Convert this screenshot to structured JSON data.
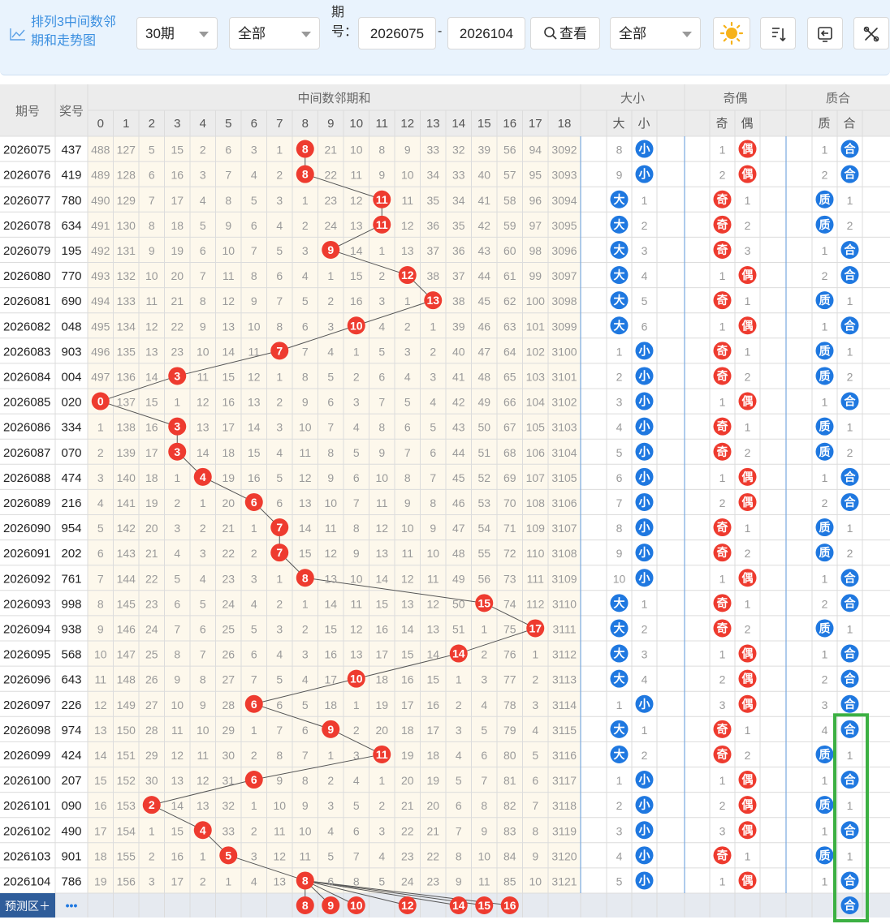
{
  "toolbar": {
    "title": "排列3中间数邻期和走势图",
    "period_select": "30期",
    "filter_select": "全部",
    "issue_label": "期号：",
    "issue_from": "2026075",
    "issue_dash": "-",
    "issue_to": "2026104",
    "query_button": "查看",
    "filter_select_2": "全部",
    "icons": [
      "sun-icon",
      "sort-icon",
      "back-icon",
      "tools-icon"
    ]
  },
  "headers": {
    "issue": "期号",
    "award": "奖号",
    "main_group": "中间数邻期和",
    "dx_group": "大小",
    "jo_group": "奇偶",
    "zh_group": "质合",
    "main_cols": [
      "0",
      "1",
      "2",
      "3",
      "4",
      "5",
      "6",
      "7",
      "8",
      "9",
      "10",
      "11",
      "12",
      "13",
      "14",
      "15",
      "16",
      "17",
      "18"
    ],
    "dx_cols": [
      "大",
      "小"
    ],
    "jo_cols": [
      "奇",
      "偶"
    ],
    "zh_cols": [
      "质",
      "合"
    ]
  },
  "rows": [
    {
      "issue": "2026075",
      "award": "437",
      "main": [
        "488",
        "127",
        "5",
        "15",
        "2",
        "6",
        "3",
        "1",
        "8",
        "21",
        "10",
        "8",
        "9",
        "33",
        "32",
        "39",
        "56",
        "94",
        "3092"
      ],
      "hit": 8,
      "dx": [
        "8",
        "小"
      ],
      "jo": [
        "1",
        "偶"
      ],
      "zh": [
        "1",
        "合"
      ]
    },
    {
      "issue": "2026076",
      "award": "419",
      "main": [
        "489",
        "128",
        "6",
        "16",
        "3",
        "7",
        "4",
        "2",
        "8",
        "22",
        "11",
        "9",
        "10",
        "34",
        "33",
        "40",
        "57",
        "95",
        "3093"
      ],
      "hit": 8,
      "dx": [
        "9",
        "小"
      ],
      "jo": [
        "2",
        "偶"
      ],
      "zh": [
        "2",
        "合"
      ]
    },
    {
      "issue": "2026077",
      "award": "780",
      "main": [
        "490",
        "129",
        "7",
        "17",
        "4",
        "8",
        "5",
        "3",
        "1",
        "23",
        "12",
        "11",
        "11",
        "35",
        "34",
        "41",
        "58",
        "96",
        "3094"
      ],
      "hit": 11,
      "dx": [
        "大",
        "1"
      ],
      "jo": [
        "奇",
        "1"
      ],
      "zh": [
        "质",
        "1"
      ]
    },
    {
      "issue": "2026078",
      "award": "634",
      "main": [
        "491",
        "130",
        "8",
        "18",
        "5",
        "9",
        "6",
        "4",
        "2",
        "24",
        "13",
        "11",
        "12",
        "36",
        "35",
        "42",
        "59",
        "97",
        "3095"
      ],
      "hit": 11,
      "dx": [
        "大",
        "2"
      ],
      "jo": [
        "奇",
        "2"
      ],
      "zh": [
        "质",
        "2"
      ]
    },
    {
      "issue": "2026079",
      "award": "195",
      "main": [
        "492",
        "131",
        "9",
        "19",
        "6",
        "10",
        "7",
        "5",
        "3",
        "9",
        "14",
        "1",
        "13",
        "37",
        "36",
        "43",
        "60",
        "98",
        "3096"
      ],
      "hit": 9,
      "dx": [
        "大",
        "3"
      ],
      "jo": [
        "奇",
        "3"
      ],
      "zh": [
        "1",
        "合"
      ]
    },
    {
      "issue": "2026080",
      "award": "770",
      "main": [
        "493",
        "132",
        "10",
        "20",
        "7",
        "11",
        "8",
        "6",
        "4",
        "1",
        "15",
        "2",
        "12",
        "38",
        "37",
        "44",
        "61",
        "99",
        "3097"
      ],
      "hit": 12,
      "dx": [
        "大",
        "4"
      ],
      "jo": [
        "1",
        "偶"
      ],
      "zh": [
        "2",
        "合"
      ]
    },
    {
      "issue": "2026081",
      "award": "690",
      "main": [
        "494",
        "133",
        "11",
        "21",
        "8",
        "12",
        "9",
        "7",
        "5",
        "2",
        "16",
        "3",
        "1",
        "13",
        "38",
        "45",
        "62",
        "100",
        "3098"
      ],
      "hit": 13,
      "dx": [
        "大",
        "5"
      ],
      "jo": [
        "奇",
        "1"
      ],
      "zh": [
        "质",
        "1"
      ]
    },
    {
      "issue": "2026082",
      "award": "048",
      "main": [
        "495",
        "134",
        "12",
        "22",
        "9",
        "13",
        "10",
        "8",
        "6",
        "3",
        "10",
        "4",
        "2",
        "1",
        "39",
        "46",
        "63",
        "101",
        "3099"
      ],
      "hit": 10,
      "dx": [
        "大",
        "6"
      ],
      "jo": [
        "1",
        "偶"
      ],
      "zh": [
        "1",
        "合"
      ]
    },
    {
      "issue": "2026083",
      "award": "903",
      "main": [
        "496",
        "135",
        "13",
        "23",
        "10",
        "14",
        "11",
        "7",
        "7",
        "4",
        "1",
        "5",
        "3",
        "2",
        "40",
        "47",
        "64",
        "102",
        "3100"
      ],
      "hit": 7,
      "dx": [
        "1",
        "小"
      ],
      "jo": [
        "奇",
        "1"
      ],
      "zh": [
        "质",
        "1"
      ]
    },
    {
      "issue": "2026084",
      "award": "004",
      "main": [
        "497",
        "136",
        "14",
        "3",
        "11",
        "15",
        "12",
        "1",
        "8",
        "5",
        "2",
        "6",
        "4",
        "3",
        "41",
        "48",
        "65",
        "103",
        "3101"
      ],
      "hit": 3,
      "dx": [
        "2",
        "小"
      ],
      "jo": [
        "奇",
        "2"
      ],
      "zh": [
        "质",
        "2"
      ]
    },
    {
      "issue": "2026085",
      "award": "020",
      "main": [
        "0",
        "137",
        "15",
        "1",
        "12",
        "16",
        "13",
        "2",
        "9",
        "6",
        "3",
        "7",
        "5",
        "4",
        "42",
        "49",
        "66",
        "104",
        "3102"
      ],
      "hit": 0,
      "dx": [
        "3",
        "小"
      ],
      "jo": [
        "1",
        "偶"
      ],
      "zh": [
        "1",
        "合"
      ]
    },
    {
      "issue": "2026086",
      "award": "334",
      "main": [
        "1",
        "138",
        "16",
        "3",
        "13",
        "17",
        "14",
        "3",
        "10",
        "7",
        "4",
        "8",
        "6",
        "5",
        "43",
        "50",
        "67",
        "105",
        "3103"
      ],
      "hit": 3,
      "dx": [
        "4",
        "小"
      ],
      "jo": [
        "奇",
        "1"
      ],
      "zh": [
        "质",
        "1"
      ]
    },
    {
      "issue": "2026087",
      "award": "070",
      "main": [
        "2",
        "139",
        "17",
        "3",
        "14",
        "18",
        "15",
        "4",
        "11",
        "8",
        "5",
        "9",
        "7",
        "6",
        "44",
        "51",
        "68",
        "106",
        "3104"
      ],
      "hit": 3,
      "dx": [
        "5",
        "小"
      ],
      "jo": [
        "奇",
        "2"
      ],
      "zh": [
        "质",
        "2"
      ]
    },
    {
      "issue": "2026088",
      "award": "474",
      "main": [
        "3",
        "140",
        "18",
        "1",
        "4",
        "19",
        "16",
        "5",
        "12",
        "9",
        "6",
        "10",
        "8",
        "7",
        "45",
        "52",
        "69",
        "107",
        "3105"
      ],
      "hit": 4,
      "dx": [
        "6",
        "小"
      ],
      "jo": [
        "1",
        "偶"
      ],
      "zh": [
        "1",
        "合"
      ]
    },
    {
      "issue": "2026089",
      "award": "216",
      "main": [
        "4",
        "141",
        "19",
        "2",
        "1",
        "20",
        "6",
        "6",
        "13",
        "10",
        "7",
        "11",
        "9",
        "8",
        "46",
        "53",
        "70",
        "108",
        "3106"
      ],
      "hit": 6,
      "dx": [
        "7",
        "小"
      ],
      "jo": [
        "2",
        "偶"
      ],
      "zh": [
        "2",
        "合"
      ]
    },
    {
      "issue": "2026090",
      "award": "954",
      "main": [
        "5",
        "142",
        "20",
        "3",
        "2",
        "21",
        "1",
        "7",
        "14",
        "11",
        "8",
        "12",
        "10",
        "9",
        "47",
        "54",
        "71",
        "109",
        "3107"
      ],
      "hit": 7,
      "dx": [
        "8",
        "小"
      ],
      "jo": [
        "奇",
        "1"
      ],
      "zh": [
        "质",
        "1"
      ]
    },
    {
      "issue": "2026091",
      "award": "202",
      "main": [
        "6",
        "143",
        "21",
        "4",
        "3",
        "22",
        "2",
        "7",
        "15",
        "12",
        "9",
        "13",
        "11",
        "10",
        "48",
        "55",
        "72",
        "110",
        "3108"
      ],
      "hit": 7,
      "dx": [
        "9",
        "小"
      ],
      "jo": [
        "奇",
        "2"
      ],
      "zh": [
        "质",
        "2"
      ]
    },
    {
      "issue": "2026092",
      "award": "761",
      "main": [
        "7",
        "144",
        "22",
        "5",
        "4",
        "23",
        "3",
        "1",
        "8",
        "13",
        "10",
        "14",
        "12",
        "11",
        "49",
        "56",
        "73",
        "111",
        "3109"
      ],
      "hit": 8,
      "dx": [
        "10",
        "小"
      ],
      "jo": [
        "1",
        "偶"
      ],
      "zh": [
        "1",
        "合"
      ]
    },
    {
      "issue": "2026093",
      "award": "998",
      "main": [
        "8",
        "145",
        "23",
        "6",
        "5",
        "24",
        "4",
        "2",
        "1",
        "14",
        "11",
        "15",
        "13",
        "12",
        "50",
        "15",
        "74",
        "112",
        "3110"
      ],
      "hit": 15,
      "dx": [
        "大",
        "1"
      ],
      "jo": [
        "奇",
        "1"
      ],
      "zh": [
        "2",
        "合"
      ]
    },
    {
      "issue": "2026094",
      "award": "938",
      "main": [
        "9",
        "146",
        "24",
        "7",
        "6",
        "25",
        "5",
        "3",
        "2",
        "15",
        "12",
        "16",
        "14",
        "13",
        "51",
        "1",
        "75",
        "17",
        "3111"
      ],
      "hit": 17,
      "dx": [
        "大",
        "2"
      ],
      "jo": [
        "奇",
        "2"
      ],
      "zh": [
        "质",
        "1"
      ]
    },
    {
      "issue": "2026095",
      "award": "568",
      "main": [
        "10",
        "147",
        "25",
        "8",
        "7",
        "26",
        "6",
        "4",
        "3",
        "16",
        "13",
        "17",
        "15",
        "14",
        "14",
        "2",
        "76",
        "1",
        "3112"
      ],
      "hit": 14,
      "dx": [
        "大",
        "3"
      ],
      "jo": [
        "1",
        "偶"
      ],
      "zh": [
        "1",
        "合"
      ]
    },
    {
      "issue": "2026096",
      "award": "643",
      "main": [
        "11",
        "148",
        "26",
        "9",
        "8",
        "27",
        "7",
        "5",
        "4",
        "17",
        "10",
        "18",
        "16",
        "15",
        "1",
        "3",
        "77",
        "2",
        "3113"
      ],
      "hit": 10,
      "dx": [
        "大",
        "4"
      ],
      "jo": [
        "2",
        "偶"
      ],
      "zh": [
        "2",
        "合"
      ]
    },
    {
      "issue": "2026097",
      "award": "226",
      "main": [
        "12",
        "149",
        "27",
        "10",
        "9",
        "28",
        "6",
        "6",
        "5",
        "18",
        "1",
        "19",
        "17",
        "16",
        "2",
        "4",
        "78",
        "3",
        "3114"
      ],
      "hit": 6,
      "dx": [
        "1",
        "小"
      ],
      "jo": [
        "3",
        "偶"
      ],
      "zh": [
        "3",
        "合"
      ]
    },
    {
      "issue": "2026098",
      "award": "974",
      "main": [
        "13",
        "150",
        "28",
        "11",
        "10",
        "29",
        "1",
        "7",
        "6",
        "9",
        "2",
        "20",
        "18",
        "17",
        "3",
        "5",
        "79",
        "4",
        "3115"
      ],
      "hit": 9,
      "dx": [
        "大",
        "1"
      ],
      "jo": [
        "奇",
        "1"
      ],
      "zh": [
        "4",
        "合"
      ]
    },
    {
      "issue": "2026099",
      "award": "424",
      "main": [
        "14",
        "151",
        "29",
        "12",
        "11",
        "30",
        "2",
        "8",
        "7",
        "1",
        "3",
        "11",
        "19",
        "18",
        "4",
        "6",
        "80",
        "5",
        "3116"
      ],
      "hit": 11,
      "dx": [
        "大",
        "2"
      ],
      "jo": [
        "奇",
        "2"
      ],
      "zh": [
        "质",
        "1"
      ]
    },
    {
      "issue": "2026100",
      "award": "207",
      "main": [
        "15",
        "152",
        "30",
        "13",
        "12",
        "31",
        "6",
        "9",
        "8",
        "2",
        "4",
        "1",
        "20",
        "19",
        "5",
        "7",
        "81",
        "6",
        "3117"
      ],
      "hit": 6,
      "dx": [
        "1",
        "小"
      ],
      "jo": [
        "1",
        "偶"
      ],
      "zh": [
        "1",
        "合"
      ]
    },
    {
      "issue": "2026101",
      "award": "090",
      "main": [
        "16",
        "153",
        "2",
        "14",
        "13",
        "32",
        "1",
        "10",
        "9",
        "3",
        "5",
        "2",
        "21",
        "20",
        "6",
        "8",
        "82",
        "7",
        "3118"
      ],
      "hit": 2,
      "dx": [
        "2",
        "小"
      ],
      "jo": [
        "2",
        "偶"
      ],
      "zh": [
        "质",
        "1"
      ]
    },
    {
      "issue": "2026102",
      "award": "490",
      "main": [
        "17",
        "154",
        "1",
        "15",
        "4",
        "33",
        "2",
        "11",
        "10",
        "4",
        "6",
        "3",
        "22",
        "21",
        "7",
        "9",
        "83",
        "8",
        "3119"
      ],
      "hit": 4,
      "dx": [
        "3",
        "小"
      ],
      "jo": [
        "3",
        "偶"
      ],
      "zh": [
        "1",
        "合"
      ]
    },
    {
      "issue": "2026103",
      "award": "901",
      "main": [
        "18",
        "155",
        "2",
        "16",
        "1",
        "5",
        "3",
        "12",
        "11",
        "5",
        "7",
        "4",
        "23",
        "22",
        "8",
        "10",
        "84",
        "9",
        "3120"
      ],
      "hit": 5,
      "dx": [
        "4",
        "小"
      ],
      "jo": [
        "奇",
        "1"
      ],
      "zh": [
        "质",
        "1"
      ]
    },
    {
      "issue": "2026104",
      "award": "786",
      "main": [
        "19",
        "156",
        "3",
        "17",
        "2",
        "1",
        "4",
        "13",
        "8",
        "6",
        "8",
        "5",
        "24",
        "23",
        "9",
        "11",
        "85",
        "10",
        "3121"
      ],
      "hit": 8,
      "dx": [
        "5",
        "小"
      ],
      "jo": [
        "1",
        "偶"
      ],
      "zh": [
        "1",
        "合"
      ]
    }
  ],
  "forecast": {
    "label": "预测区＋",
    "more": "•••",
    "balls": [
      {
        "col": 8,
        "text": "8"
      },
      {
        "col": 9,
        "text": "9"
      },
      {
        "col": 10,
        "text": "10"
      },
      {
        "col": 12,
        "text": "12"
      },
      {
        "col": 14,
        "text": "14"
      },
      {
        "col": 15,
        "text": "15"
      },
      {
        "col": 16,
        "text": "16"
      }
    ],
    "zh_ball": "合"
  },
  "colors": {
    "red_ball": "#ee3b2f",
    "blue_ball": "#1f78e0",
    "header_bg": "#ececec",
    "main_bg": "#fdf8ec",
    "stat_bg": "#ffffff",
    "toolbar_bg": "#e9f3fd",
    "highlight_box": "#3cb043",
    "forecast_bg": "#e6eaf0"
  }
}
